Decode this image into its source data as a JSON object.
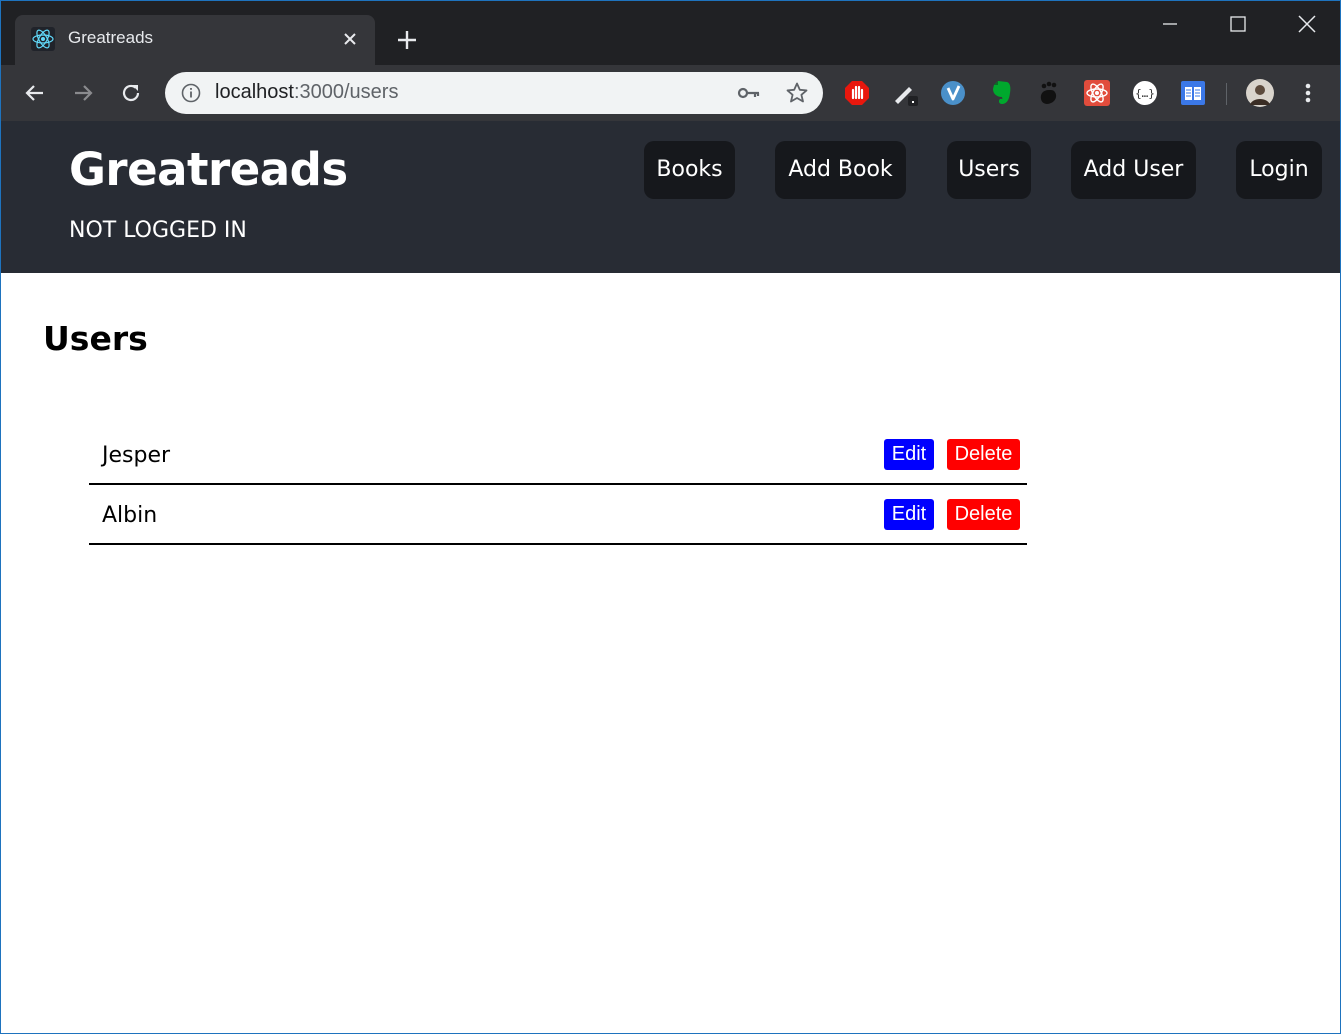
{
  "browser": {
    "tab_title": "Greatreads",
    "url_host": "localhost",
    "url_path": ":3000/users",
    "icons": {
      "tab_favicon": "react-icon",
      "close": "close-icon",
      "new_tab": "plus-icon",
      "back": "back-arrow-icon",
      "forward": "forward-arrow-icon",
      "reload": "reload-icon",
      "info": "info-icon",
      "key": "key-icon",
      "star": "star-icon",
      "menu": "kebab-menu-icon"
    },
    "extensions": [
      "adblock-icon",
      "pen-icon",
      "vimium-icon",
      "evernote-icon",
      "gnome-icon",
      "react-devtools-icon",
      "json-viewer-icon",
      "reader-icon"
    ]
  },
  "header": {
    "brand": "Greatreads",
    "login_status": "NOT LOGGED IN",
    "nav": [
      {
        "label": "Books"
      },
      {
        "label": "Add Book"
      },
      {
        "label": "Users"
      },
      {
        "label": "Add User"
      },
      {
        "label": "Login"
      }
    ]
  },
  "main": {
    "title": "Users",
    "users": [
      {
        "name": "Jesper",
        "edit_label": "Edit",
        "delete_label": "Delete"
      },
      {
        "name": "Albin",
        "edit_label": "Edit",
        "delete_label": "Delete"
      }
    ]
  },
  "colors": {
    "header_bg": "#282c34",
    "nav_button_bg": "#16181c",
    "edit_button": "#0000ff",
    "delete_button": "#ff0000"
  }
}
